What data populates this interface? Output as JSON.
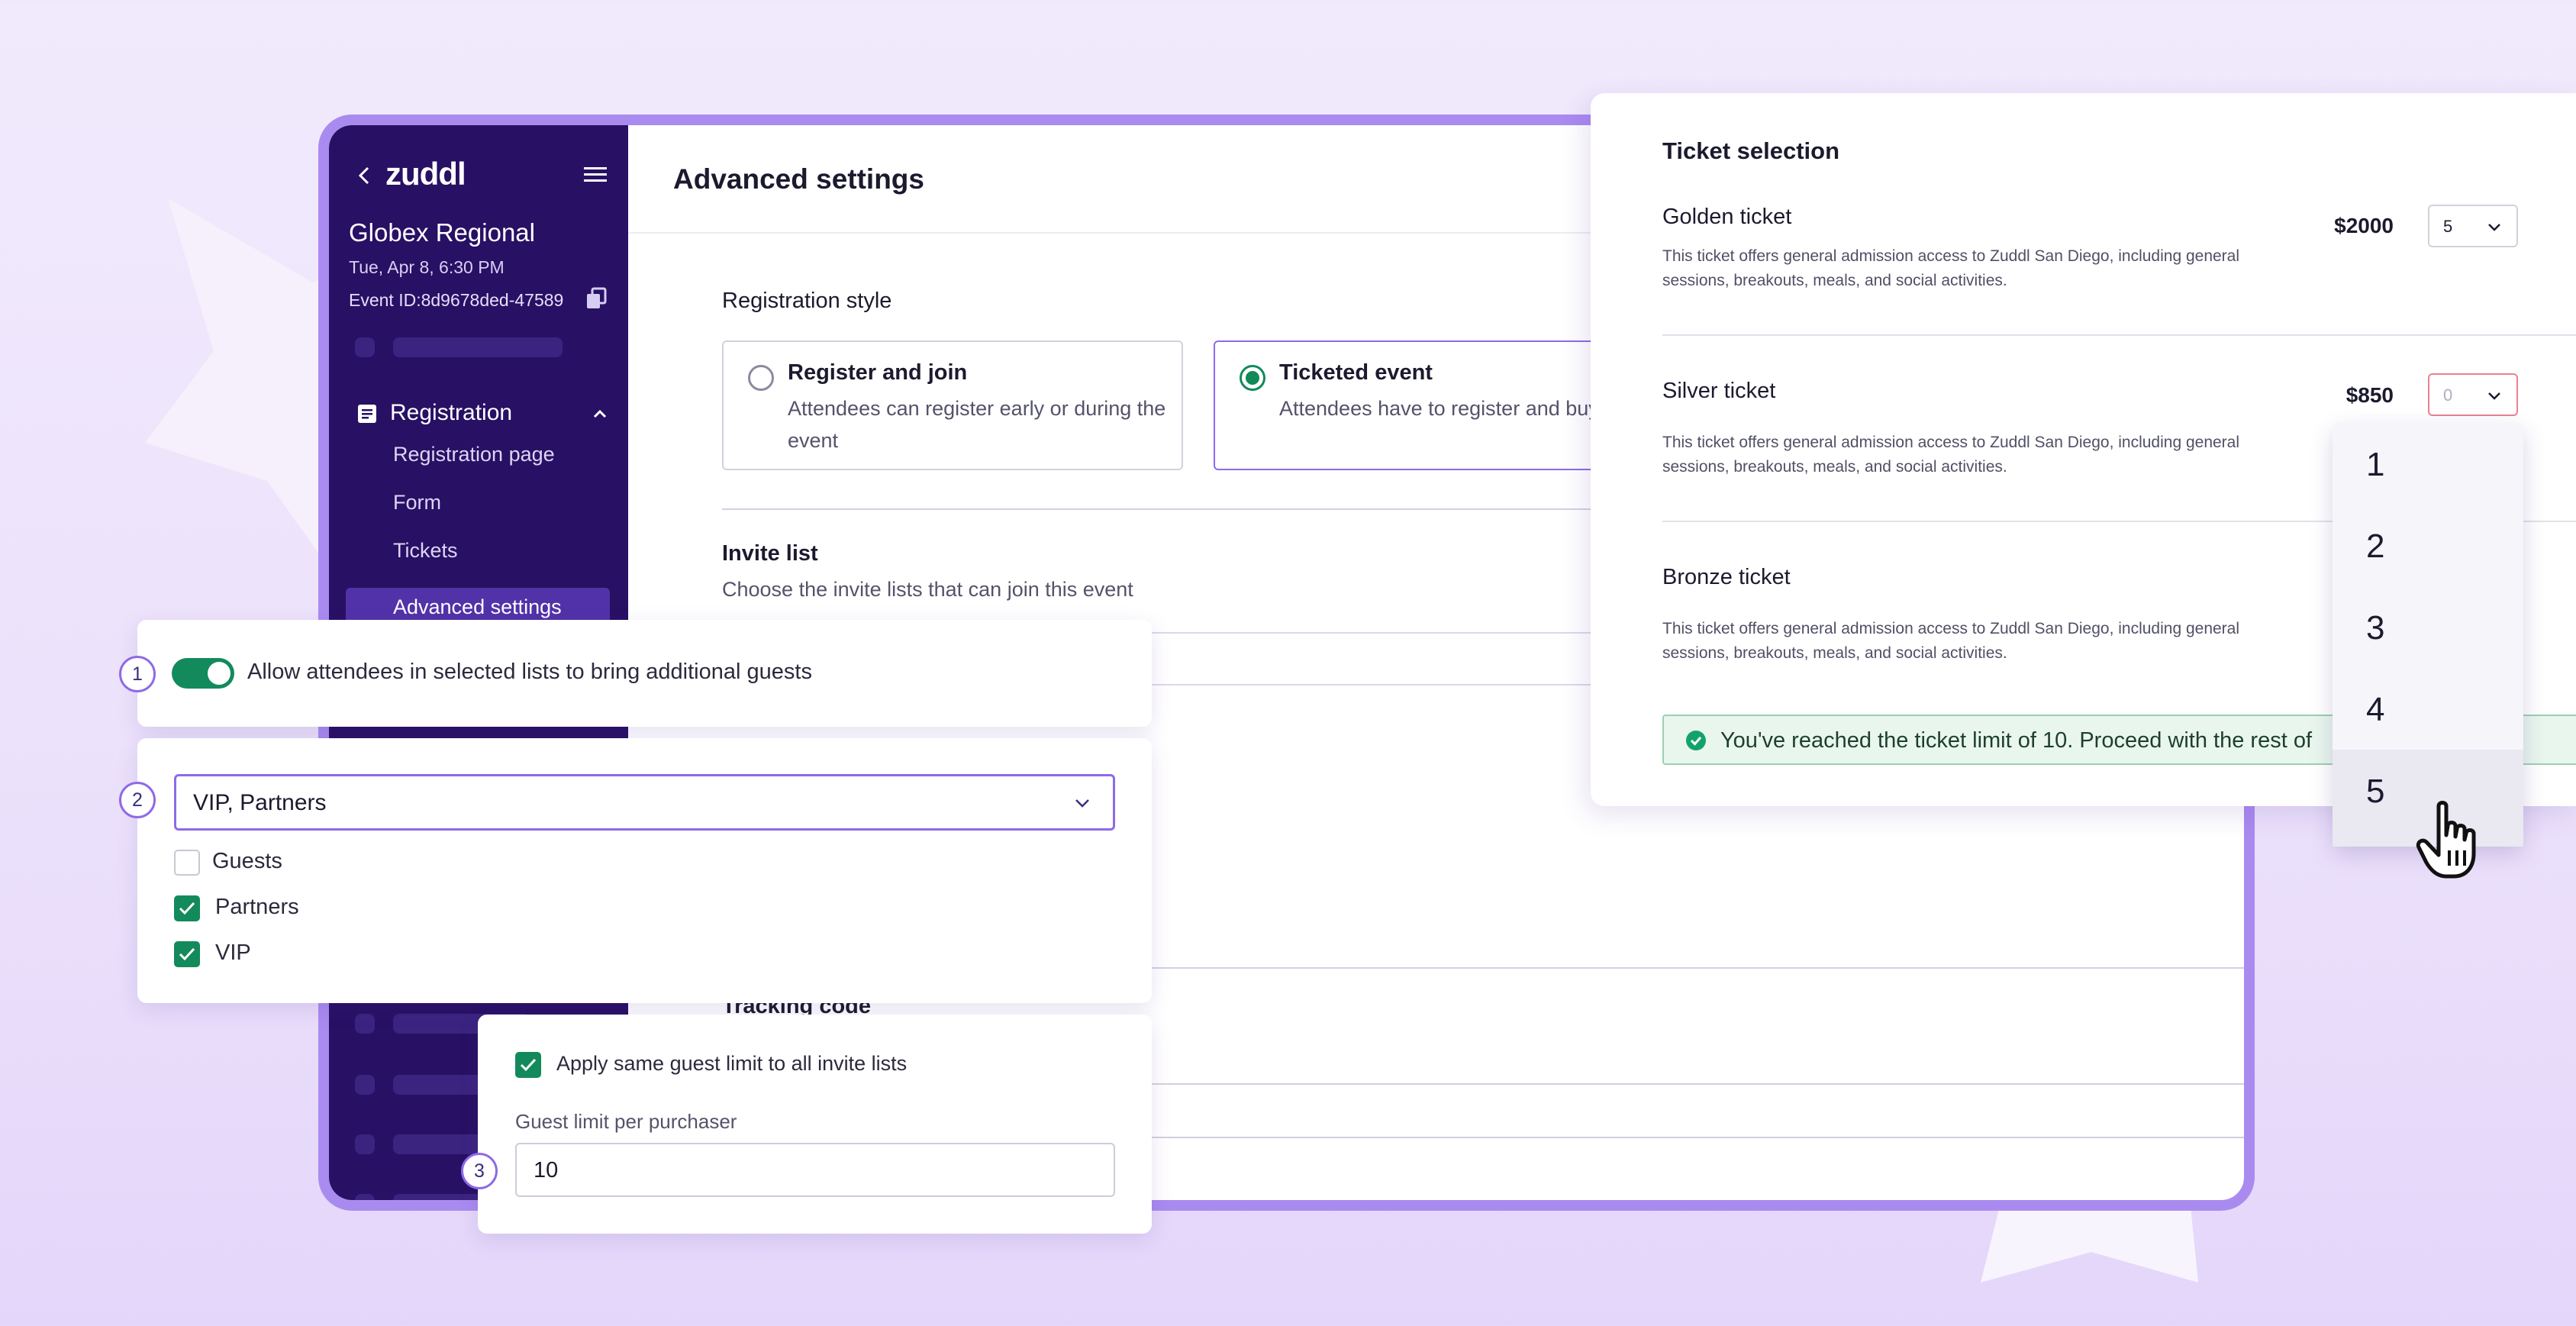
{
  "app": {
    "logo": "zuddl",
    "event_name": "Globex Regional",
    "event_date": "Tue, Apr 8, 6:30 PM",
    "event_id": "Event ID:8d9678ded-47589"
  },
  "sidebar": {
    "section": "Registration",
    "items": [
      {
        "label": "Registration page"
      },
      {
        "label": "Form"
      },
      {
        "label": "Tickets"
      },
      {
        "label": "Advanced settings",
        "active": true
      }
    ]
  },
  "main": {
    "title": "Advanced settings",
    "registration_style": {
      "label": "Registration style",
      "options": [
        {
          "title": "Register and join",
          "desc": "Attendees can register early or during the event",
          "selected": false
        },
        {
          "title": "Ticketed event",
          "desc": "Attendees have to register and buy tickets",
          "selected": true
        }
      ]
    },
    "invite_list": {
      "label": "Invite list",
      "subtitle": "Choose the invite lists that can join this event"
    },
    "tracking": {
      "label": "Tracking code"
    }
  },
  "guests": {
    "step1": "1",
    "allow_toggle": {
      "label": "Allow attendees in selected lists to bring additional guests",
      "on": true
    },
    "step2": "2",
    "lists_select": {
      "value": "VIP, Partners"
    },
    "lists": [
      {
        "label": "Guests",
        "checked": false
      },
      {
        "label": "Partners",
        "checked": true
      },
      {
        "label": "VIP",
        "checked": true
      }
    ],
    "step3": "3",
    "apply_same": {
      "label": "Apply same guest limit to all invite lists",
      "checked": true
    },
    "limit": {
      "label": "Guest limit per purchaser",
      "value": "10"
    }
  },
  "tickets": {
    "title": "Ticket selection",
    "items": [
      {
        "name": "Golden ticket",
        "price": "$2000",
        "qty": "5",
        "desc": "This ticket offers general admission access to Zuddl San Diego, including general sessions, breakouts, meals, and social activities."
      },
      {
        "name": "Silver ticket",
        "price": "$850",
        "qty": "0",
        "desc": "This ticket offers general admission access to Zuddl San Diego, including general sessions, breakouts, meals, and social activities."
      },
      {
        "name": "Bronze ticket",
        "price": "",
        "qty": "",
        "desc": "This ticket offers general admission access to Zuddl San Diego, including general sessions, breakouts, meals, and social activities."
      }
    ],
    "alert": "You've reached the ticket limit of 10. Proceed with the rest of",
    "dropdown_options": [
      "1",
      "2",
      "3",
      "4",
      "5"
    ],
    "dropdown_highlighted": "5"
  },
  "colors": {
    "sidebar": "#281064",
    "accent": "#8e6ae8",
    "success": "#138a5b",
    "frame": "#a98bf0"
  }
}
